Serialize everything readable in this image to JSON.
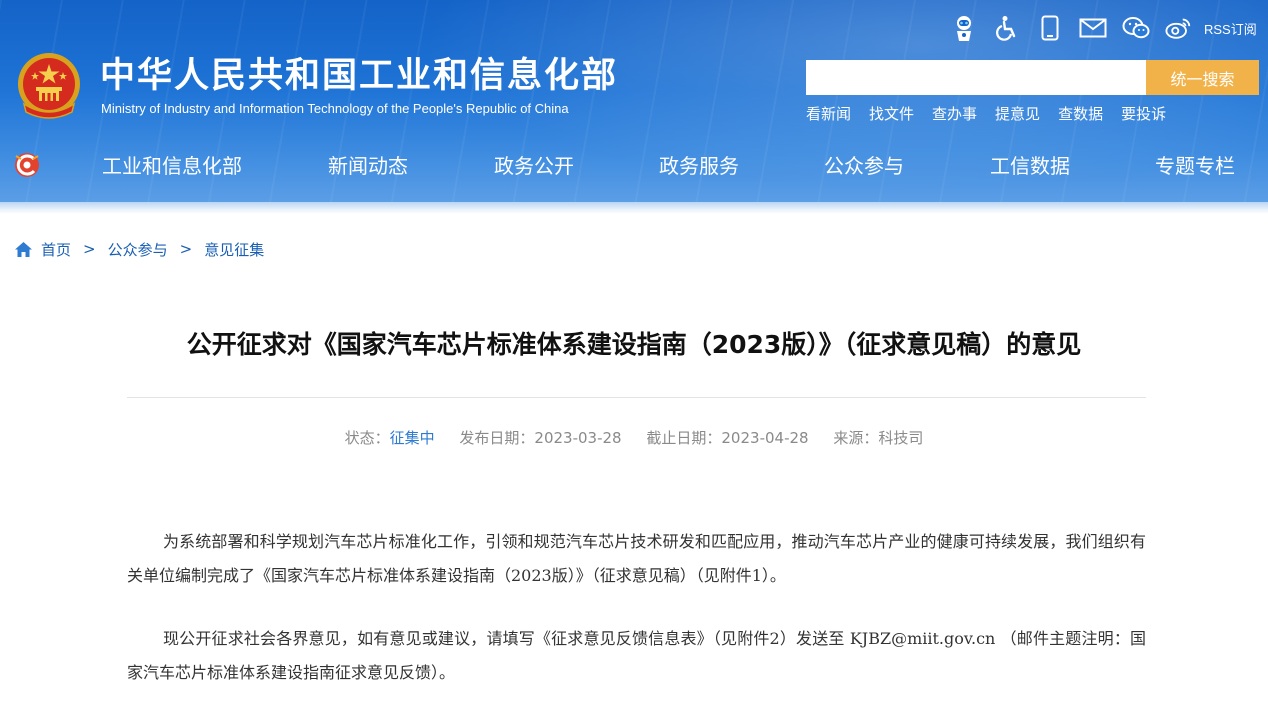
{
  "header": {
    "title": "中华人民共和国工业和信息化部",
    "subtitle": "Ministry of Industry and Information Technology of the People's Republic of China",
    "rss_label": "RSS订阅",
    "icons": [
      "robot-icon",
      "accessibility-icon",
      "mobile-icon",
      "mail-icon",
      "wechat-icon",
      "weibo-icon"
    ],
    "search": {
      "value": "",
      "placeholder": "",
      "button_label": "统一搜索"
    },
    "quick_links": [
      "看新闻",
      "找文件",
      "查办事",
      "提意见",
      "查数据",
      "要投诉"
    ],
    "nav": [
      "工业和信息化部",
      "新闻动态",
      "政务公开",
      "政务服务",
      "公众参与",
      "工信数据",
      "专题专栏"
    ]
  },
  "breadcrumb": {
    "home": "首页",
    "separator": ">",
    "level1": "公众参与",
    "level2": "意见征集"
  },
  "article": {
    "title": "公开征求对《国家汽车芯片标准体系建设指南（2023版）》（征求意见稿）的意见",
    "meta": {
      "status_label": "状态：",
      "status_value": "征集中",
      "publish": "发布日期：2023-03-28",
      "deadline": "截止日期：2023-04-28",
      "source": "来源：科技司"
    },
    "paragraphs": [
      "为系统部署和科学规划汽车芯片标准化工作，引领和规范汽车芯片技术研发和匹配应用，推动汽车芯片产业的健康可持续发展，我们组织有关单位编制完成了《国家汽车芯片标准体系建设指南（2023版）》（征求意见稿）（见附件1）。",
      "现公开征求社会各界意见，如有意见或建议，请填写《征求意见反馈信息表》（见附件2）发送至 KJBZ@miit.gov.cn （邮件主题注明：国家汽车芯片标准体系建设指南征求意见反馈）。"
    ]
  },
  "colors": {
    "header_blue": "#1f74d6",
    "search_button": "#f2b24a",
    "link_blue": "#1a5fb4",
    "status_blue": "#2e7bd2"
  }
}
